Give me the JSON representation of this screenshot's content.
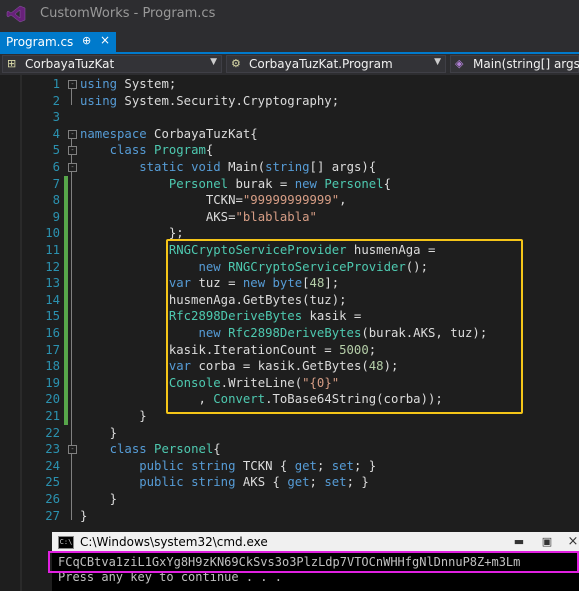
{
  "window": {
    "title": "CustomWorks - Program.cs"
  },
  "tab": {
    "label": "Program.cs",
    "pin": "⊕",
    "close": "×"
  },
  "nav": {
    "project": "CorbayaTuzKat",
    "class": "CorbayaTuzKat.Program",
    "member": "Main(string[] args)"
  },
  "code_lines": [
    {
      "n": "1",
      "segs": [
        {
          "t": "using ",
          "c": "kw"
        },
        {
          "t": "System;"
        }
      ]
    },
    {
      "n": "2",
      "segs": [
        {
          "t": "using ",
          "c": "kw"
        },
        {
          "t": "System.Security.Cryptography;"
        }
      ]
    },
    {
      "n": "3",
      "segs": []
    },
    {
      "n": "4",
      "segs": [
        {
          "t": "namespace ",
          "c": "kw"
        },
        {
          "t": "CorbayaTuzKat{"
        }
      ]
    },
    {
      "n": "5",
      "segs": [
        {
          "t": "    "
        },
        {
          "t": "class ",
          "c": "kw"
        },
        {
          "t": "Program",
          "c": "ty"
        },
        {
          "t": "{"
        }
      ]
    },
    {
      "n": "6",
      "segs": [
        {
          "t": "        "
        },
        {
          "t": "static ",
          "c": "kw"
        },
        {
          "t": "void ",
          "c": "kw"
        },
        {
          "t": "Main("
        },
        {
          "t": "string",
          "c": "kw"
        },
        {
          "t": "[] args){"
        }
      ]
    },
    {
      "n": "7",
      "segs": [
        {
          "t": "            "
        },
        {
          "t": "Personel",
          "c": "ty"
        },
        {
          "t": " burak = "
        },
        {
          "t": "new ",
          "c": "kw"
        },
        {
          "t": "Personel",
          "c": "ty"
        },
        {
          "t": "{"
        }
      ]
    },
    {
      "n": "8",
      "segs": [
        {
          "t": "                 TCKN="
        },
        {
          "t": "\"99999999999\"",
          "c": "st"
        },
        {
          "t": ","
        }
      ]
    },
    {
      "n": "9",
      "segs": [
        {
          "t": "                 AKS="
        },
        {
          "t": "\"blablabla\"",
          "c": "st"
        }
      ]
    },
    {
      "n": "10",
      "segs": [
        {
          "t": "            };"
        }
      ]
    },
    {
      "n": "11",
      "segs": [
        {
          "t": "            "
        },
        {
          "t": "RNGCryptoServiceProvider",
          "c": "ty"
        },
        {
          "t": " husmenAga ="
        }
      ]
    },
    {
      "n": "12",
      "segs": [
        {
          "t": "                "
        },
        {
          "t": "new ",
          "c": "kw"
        },
        {
          "t": "RNGCryptoServiceProvider",
          "c": "ty"
        },
        {
          "t": "();"
        }
      ]
    },
    {
      "n": "13",
      "segs": [
        {
          "t": "            "
        },
        {
          "t": "var ",
          "c": "kw"
        },
        {
          "t": "tuz = "
        },
        {
          "t": "new ",
          "c": "kw"
        },
        {
          "t": "byte",
          "c": "kw"
        },
        {
          "t": "["
        },
        {
          "t": "48",
          "c": "nm"
        },
        {
          "t": "];"
        }
      ]
    },
    {
      "n": "14",
      "segs": [
        {
          "t": "            husmenAga.GetBytes(tuz);"
        }
      ]
    },
    {
      "n": "15",
      "segs": [
        {
          "t": "            "
        },
        {
          "t": "Rfc2898DeriveBytes",
          "c": "ty"
        },
        {
          "t": " kasik ="
        }
      ]
    },
    {
      "n": "16",
      "segs": [
        {
          "t": "                "
        },
        {
          "t": "new ",
          "c": "kw"
        },
        {
          "t": "Rfc2898DeriveBytes",
          "c": "ty"
        },
        {
          "t": "(burak.AKS, tuz);"
        }
      ]
    },
    {
      "n": "17",
      "segs": [
        {
          "t": "            kasik.IterationCount = "
        },
        {
          "t": "5000",
          "c": "nm"
        },
        {
          "t": ";"
        }
      ]
    },
    {
      "n": "18",
      "segs": [
        {
          "t": "            "
        },
        {
          "t": "var ",
          "c": "kw"
        },
        {
          "t": "corba = kasik.GetBytes("
        },
        {
          "t": "48",
          "c": "nm"
        },
        {
          "t": ");"
        }
      ]
    },
    {
      "n": "19",
      "segs": [
        {
          "t": "            "
        },
        {
          "t": "Console",
          "c": "ty"
        },
        {
          "t": ".WriteLine("
        },
        {
          "t": "\"{0}\"",
          "c": "st"
        }
      ]
    },
    {
      "n": "20",
      "segs": [
        {
          "t": "                , "
        },
        {
          "t": "Convert",
          "c": "ty"
        },
        {
          "t": ".ToBase64String(corba));"
        }
      ]
    },
    {
      "n": "21",
      "segs": [
        {
          "t": "        }"
        }
      ]
    },
    {
      "n": "22",
      "segs": [
        {
          "t": "    }"
        }
      ]
    },
    {
      "n": "23",
      "segs": [
        {
          "t": "    "
        },
        {
          "t": "class ",
          "c": "kw"
        },
        {
          "t": "Personel",
          "c": "ty"
        },
        {
          "t": "{"
        }
      ]
    },
    {
      "n": "24",
      "segs": [
        {
          "t": "        "
        },
        {
          "t": "public ",
          "c": "kw"
        },
        {
          "t": "string ",
          "c": "kw"
        },
        {
          "t": "TCKN { "
        },
        {
          "t": "get",
          "c": "kw"
        },
        {
          "t": "; "
        },
        {
          "t": "set",
          "c": "kw"
        },
        {
          "t": "; }"
        }
      ]
    },
    {
      "n": "25",
      "segs": [
        {
          "t": "        "
        },
        {
          "t": "public ",
          "c": "kw"
        },
        {
          "t": "string ",
          "c": "kw"
        },
        {
          "t": "AKS { "
        },
        {
          "t": "get",
          "c": "kw"
        },
        {
          "t": "; "
        },
        {
          "t": "set",
          "c": "kw"
        },
        {
          "t": "; }"
        }
      ]
    },
    {
      "n": "26",
      "segs": [
        {
          "t": "    }"
        }
      ]
    },
    {
      "n": "27",
      "segs": [
        {
          "t": "}"
        }
      ]
    }
  ],
  "console": {
    "title": "C:\\Windows\\system32\\cmd.exe",
    "buttons": {
      "minimize": "▬",
      "maximize": "▣",
      "close": "×"
    },
    "output_line": "FCqCBtva1ziL1GxYg8H9zKN69CkSvs3o3PlzLdp7VTOCnWHHfgNlDnnuP8Z+m3Lm",
    "prompt_line": "Press any key to continue . . ."
  },
  "colors": {
    "highlight_box": "#f5c518",
    "output_highlight": "#e020e0",
    "accent": "#007acc"
  }
}
